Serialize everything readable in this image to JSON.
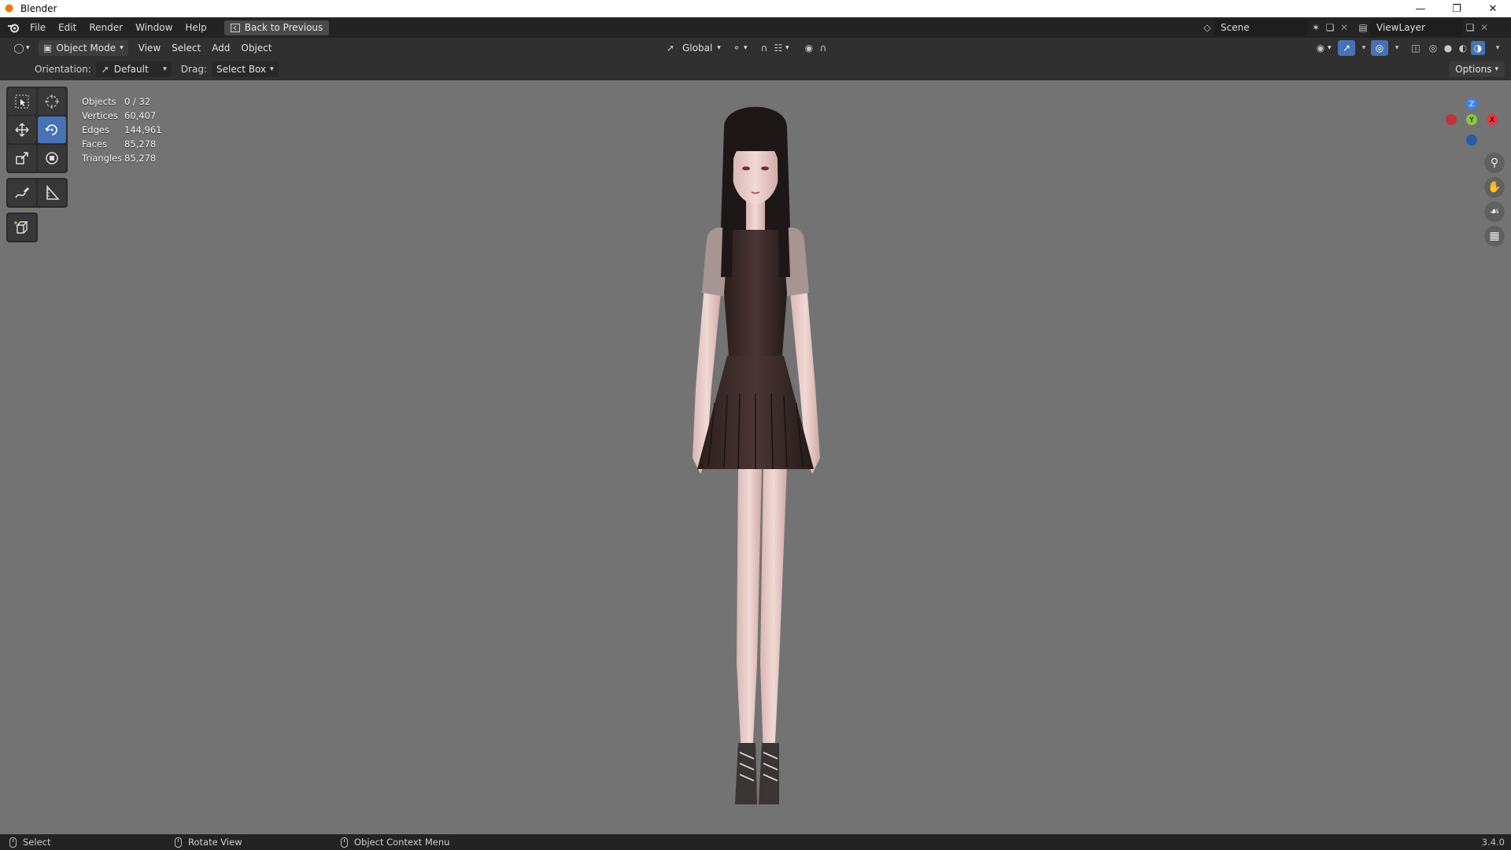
{
  "window": {
    "title": "Blender",
    "controls": [
      "minimize-icon",
      "restore-icon",
      "close-icon"
    ]
  },
  "topbar": {
    "menus": [
      "File",
      "Edit",
      "Render",
      "Window",
      "Help"
    ],
    "back_button": "Back to Previous",
    "scene": "Scene",
    "view_layer": "ViewLayer"
  },
  "viewport_header": {
    "mode": "Object Mode",
    "menus": [
      "View",
      "Select",
      "Add",
      "Object"
    ],
    "transform_orientation": "Global"
  },
  "tool_settings": {
    "orientation_label": "Orientation:",
    "orientation_value": "Default",
    "drag_label": "Drag:",
    "drag_value": "Select Box",
    "options": "Options"
  },
  "stats": [
    {
      "label": "Objects",
      "value": "0 / 32"
    },
    {
      "label": "Vertices",
      "value": "60,407"
    },
    {
      "label": "Edges",
      "value": "144,961"
    },
    {
      "label": "Faces",
      "value": "85,278"
    },
    {
      "label": "Triangles",
      "value": "85,278"
    }
  ],
  "gizmo": {
    "z": "Z",
    "y": "Y",
    "x": "X"
  },
  "statusbar": {
    "select": "Select",
    "rotate": "Rotate View",
    "context": "Object Context Menu",
    "version": "3.4.0"
  },
  "colors": {
    "viewport_bg": "#737373",
    "accent": "#4772b3",
    "axis_x": "#e8383d",
    "axis_y": "#8cc63f",
    "axis_z": "#3b82f6"
  }
}
